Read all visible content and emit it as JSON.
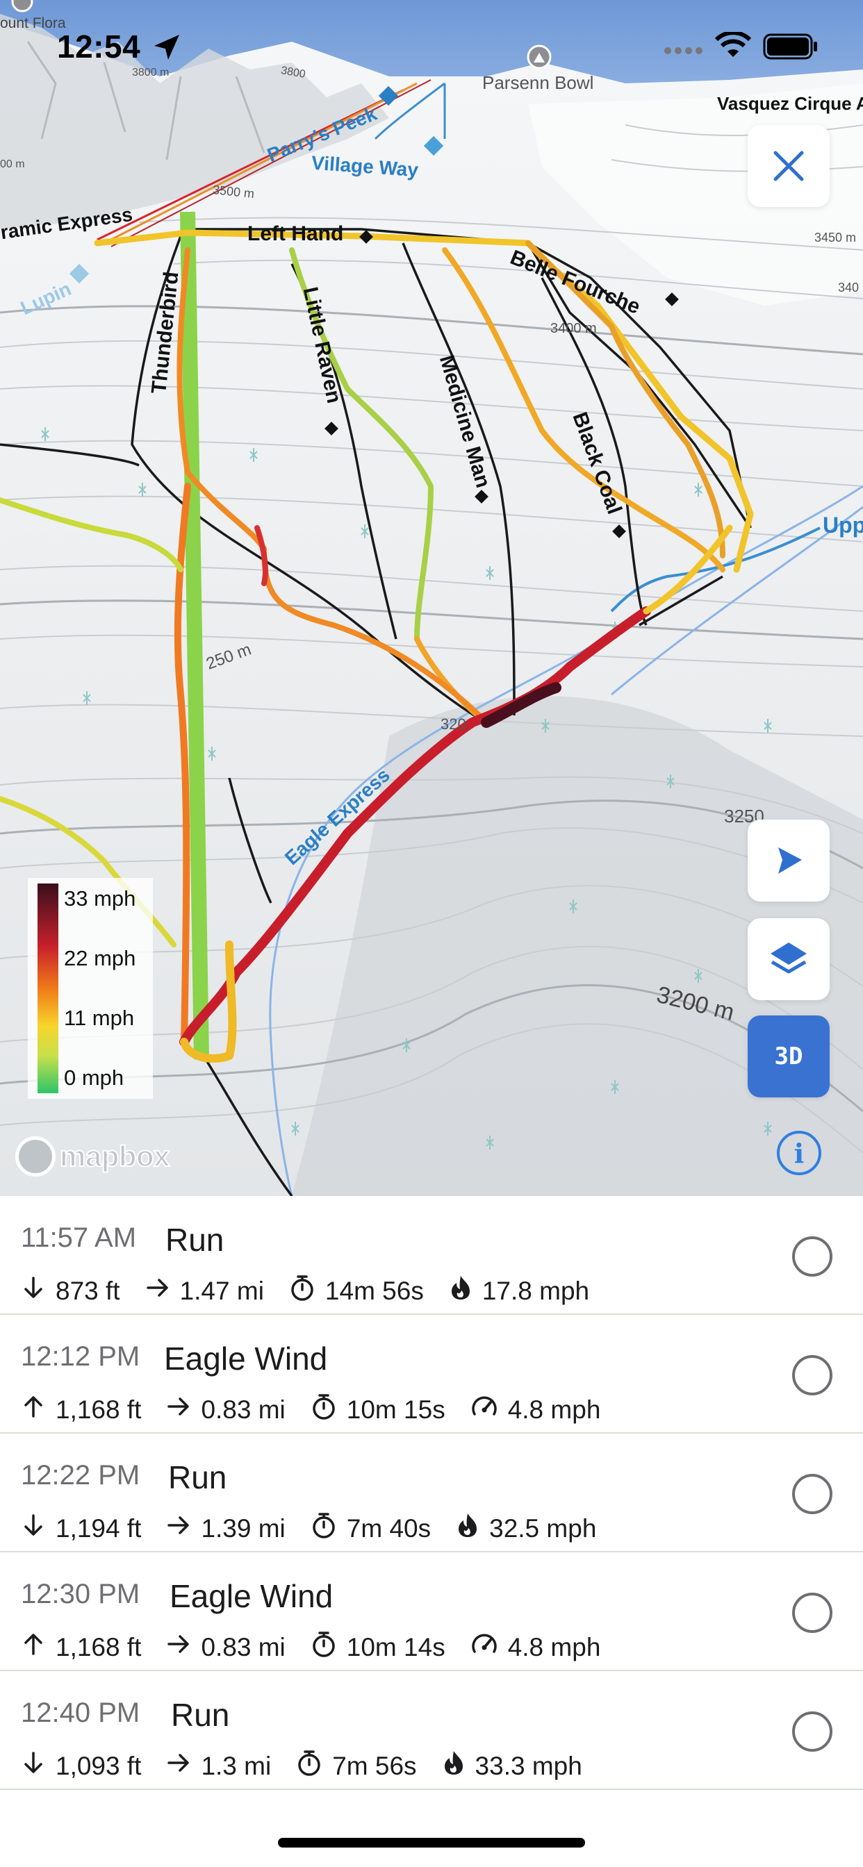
{
  "status_bar": {
    "time": "12:54"
  },
  "map": {
    "labels": {
      "mount_flora": "ount Flora",
      "parsenn_bowl": "Parsenn Bowl",
      "vasquez_cirque": "Vasquez Cirque A",
      "parrys_peek": "Parry's Peek",
      "village_way": "Village Way",
      "panoramic_express": "ramic Express",
      "lupin": "Lupin",
      "left_hand": "Left Hand",
      "belle_fourche": "Belle Fourche",
      "thunderbird": "Thunderbird",
      "little_raven": "Little Raven",
      "medicine_man": "Medicine Man",
      "black_coal": "Black Coal",
      "upper": "Upp",
      "contour_3800": "3800 m",
      "contour_3800b": "3800",
      "contour_3500": "3500 m",
      "contour_3450": "3450 m",
      "contour_340": "340",
      "contour_3400": "3400 m",
      "contour_3250": "250 m",
      "contour_3200": "320",
      "contour_3250b": "3250",
      "contour_3200b": "3200 m",
      "contour_left": "00 m",
      "eagle_express": "Eagle Express"
    },
    "speed_legend": [
      "33 mph",
      "22 mph",
      "11 mph",
      "0 mph"
    ],
    "button_3d": "3D",
    "info_glyph": "i",
    "attribution": "mapbox",
    "colors": {
      "accent": "#3a72d2",
      "info": "#2f7fe0"
    }
  },
  "activities": [
    {
      "time": "11:57 AM",
      "name": "Run",
      "vertical": "873 ft",
      "vertical_icon": "arrow-down-icon",
      "distance": "1.47 mi",
      "duration": "14m 56s",
      "speed": "17.8 mph",
      "speed_icon": "flame-icon"
    },
    {
      "time": "12:12 PM",
      "name": "Eagle Wind",
      "vertical": "1,168 ft",
      "vertical_icon": "arrow-up-icon",
      "distance": "0.83 mi",
      "duration": "10m 15s",
      "speed": "4.8 mph",
      "speed_icon": "speedometer-icon"
    },
    {
      "time": "12:22 PM",
      "name": "Run",
      "vertical": "1,194 ft",
      "vertical_icon": "arrow-down-icon",
      "distance": "1.39 mi",
      "duration": "7m 40s",
      "speed": "32.5 mph",
      "speed_icon": "flame-icon"
    },
    {
      "time": "12:30 PM",
      "name": "Eagle Wind",
      "vertical": "1,168 ft",
      "vertical_icon": "arrow-up-icon",
      "distance": "0.83 mi",
      "duration": "10m 14s",
      "speed": "4.8 mph",
      "speed_icon": "speedometer-icon"
    },
    {
      "time": "12:40 PM",
      "name": "Run",
      "vertical": "1,093 ft",
      "vertical_icon": "arrow-down-icon",
      "distance": "1.3 mi",
      "duration": "7m 56s",
      "speed": "33.3 mph",
      "speed_icon": "flame-icon"
    }
  ]
}
